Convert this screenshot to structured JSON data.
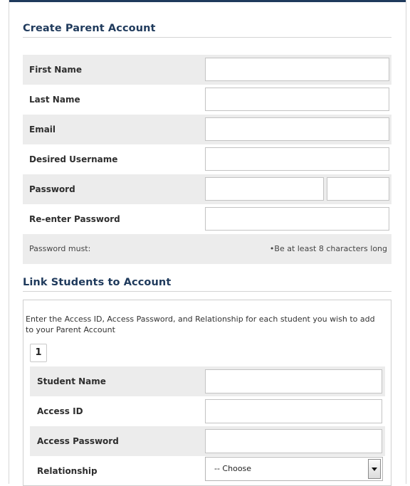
{
  "parent_account": {
    "title": "Create Parent Account",
    "fields": {
      "first_name": {
        "label": "First Name",
        "value": ""
      },
      "last_name": {
        "label": "Last Name",
        "value": ""
      },
      "email": {
        "label": "Email",
        "value": ""
      },
      "username": {
        "label": "Desired Username",
        "value": ""
      },
      "password": {
        "label": "Password",
        "value": "",
        "confirm_value": ""
      },
      "reenter_password": {
        "label": "Re-enter Password",
        "value": ""
      }
    },
    "password_rules": {
      "label": "Password must:",
      "rule": "•Be at least 8 characters long"
    }
  },
  "link_students": {
    "title": "Link Students to Account",
    "intro": "Enter the Access ID, Access Password, and Relationship for each student you wish to add to your Parent Account",
    "student_number": "1",
    "fields": {
      "student_name": {
        "label": "Student Name",
        "value": ""
      },
      "access_id": {
        "label": "Access ID",
        "value": ""
      },
      "access_password": {
        "label": "Access Password",
        "value": ""
      },
      "relationship": {
        "label": "Relationship",
        "selected": "-- Choose"
      }
    }
  },
  "colors": {
    "accent": "#1f3a5c",
    "row_shade": "#ececec",
    "border": "#c3c3c3"
  }
}
